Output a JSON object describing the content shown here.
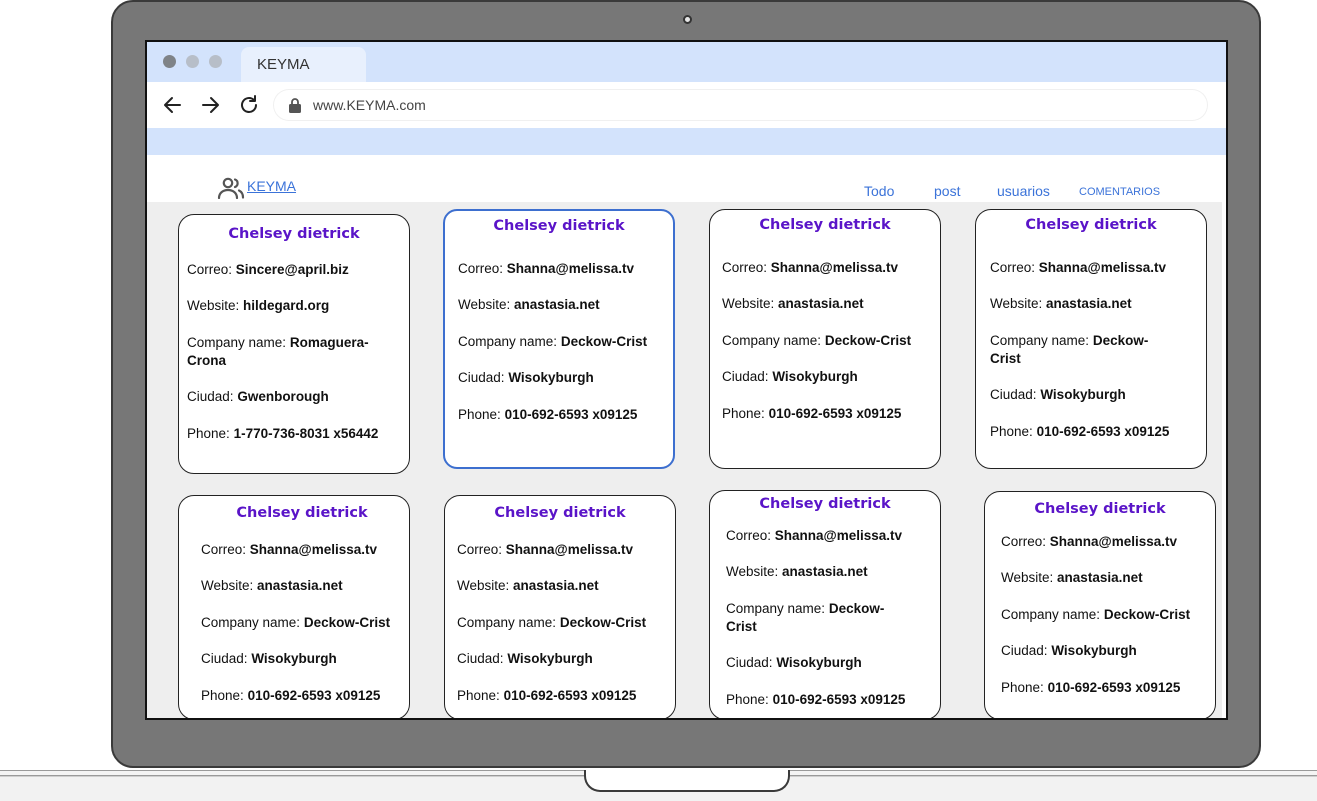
{
  "browser": {
    "tab_title": "KEYMA",
    "url": "www.KEYMA.com",
    "window_dots": [
      "#7f8387",
      "#b7bec8",
      "#b7bec8"
    ]
  },
  "app": {
    "brand": "KEYMA",
    "brand_icon": "users-icon",
    "nav": [
      "Todo",
      "post",
      "usuarios",
      "COMENTARIOS"
    ]
  },
  "labels": {
    "email": "Correo:",
    "website": "Website:",
    "company": "Company name:",
    "city": "Ciudad:",
    "phone": "Phone:"
  },
  "cards": [
    {
      "name": "Chelsey dietrick",
      "email": "Sincere@april.biz",
      "website": "hildegard.org",
      "company": "Romaguera-Crona",
      "city": "Gwenborough",
      "phone": "1-770-736-8031 x56442"
    },
    {
      "name": "Chelsey dietrick",
      "email": "Shanna@melissa.tv",
      "website": "anastasia.net",
      "company": "Deckow-Crist",
      "city": "Wisokyburgh",
      "phone": "010-692-6593 x09125"
    },
    {
      "name": "Chelsey dietrick",
      "email": "Shanna@melissa.tv",
      "website": "anastasia.net",
      "company": "Deckow-Crist",
      "city": "Wisokyburgh",
      "phone": "010-692-6593 x09125"
    },
    {
      "name": "Chelsey dietrick",
      "email": "Shanna@melissa.tv",
      "website": "anastasia.net",
      "company": "Deckow-Crist",
      "city": "Wisokyburgh",
      "phone": "010-692-6593 x09125"
    },
    {
      "name": "Chelsey dietrick",
      "email": "Shanna@melissa.tv",
      "website": "anastasia.net",
      "company": "Deckow-Crist",
      "city": "Wisokyburgh",
      "phone": "010-692-6593 x09125"
    },
    {
      "name": "Chelsey dietrick",
      "email": "Shanna@melissa.tv",
      "website": "anastasia.net",
      "company": "Deckow-Crist",
      "city": "Wisokyburgh",
      "phone": "010-692-6593 x09125"
    },
    {
      "name": "Chelsey dietrick",
      "email": "Shanna@melissa.tv",
      "website": "anastasia.net",
      "company": "Deckow-Crist",
      "city": "Wisokyburgh",
      "phone": "010-692-6593 x09125"
    },
    {
      "name": "Chelsey dietrick",
      "email": "Shanna@melissa.tv",
      "website": "anastasia.net",
      "company": "Deckow-Crist",
      "city": "Wisokyburgh",
      "phone": "010-692-6593 x09125"
    }
  ]
}
